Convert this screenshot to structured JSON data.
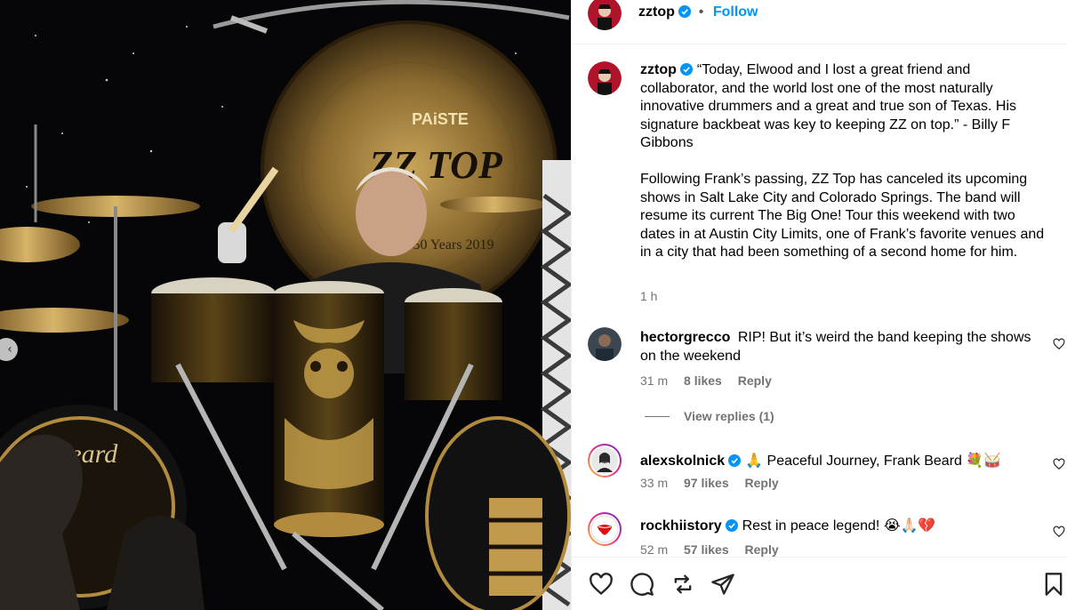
{
  "post": {
    "author": "zztop",
    "follow_label": "Follow",
    "separator": "•",
    "caption_p1": "“Today, Elwood and I lost a great friend and collaborator, and the world lost one of the most naturally innovative drummers and a great and true son of Texas. His signature backbeat was key to keeping ZZ on top.” - Billy F Gibbons",
    "caption_p2": "Following Frank’s passing, ZZ Top has canceled its upcoming shows in Salt Lake City and Colorado Springs. The band will resume its current The Big One! Tour this weekend with two dates in at Austin City Limits, one of Frank’s favorite venues and in a city that had been something of a second home for him.",
    "time": "1 h"
  },
  "photo": {
    "gong_brand": "PAiSTE",
    "gong_logo": "ZZ TOP",
    "gong_text": "50 Years 2019",
    "drum_brand": "Beard",
    "icons": [
      "chevron-left-icon"
    ]
  },
  "comments": [
    {
      "user": "hectorgrecco",
      "verified": false,
      "text": "RIP! But it’s weird the band keeping the shows on the weekend",
      "time": "31 m",
      "likes": "8 likes",
      "reply": "Reply"
    },
    {
      "user": "alexskolnick",
      "verified": true,
      "text": "🙏 Peaceful Journey, Frank Beard 💐🥁",
      "time": "33 m",
      "likes": "97 likes",
      "reply": "Reply"
    },
    {
      "user": "rockhiistory",
      "verified": true,
      "text": "Rest in peace legend! 😭🙏🏻💔",
      "time": "52 m",
      "likes": "57 likes",
      "reply": "Reply"
    }
  ],
  "view_replies": "View replies (1)",
  "action_icons": [
    "heart-icon",
    "comment-icon",
    "repost-icon",
    "share-icon",
    "bookmark-icon"
  ],
  "colors": {
    "accent": "#0095f6",
    "muted": "#737373",
    "verified": "#0095f6",
    "divider": "#efefef"
  }
}
